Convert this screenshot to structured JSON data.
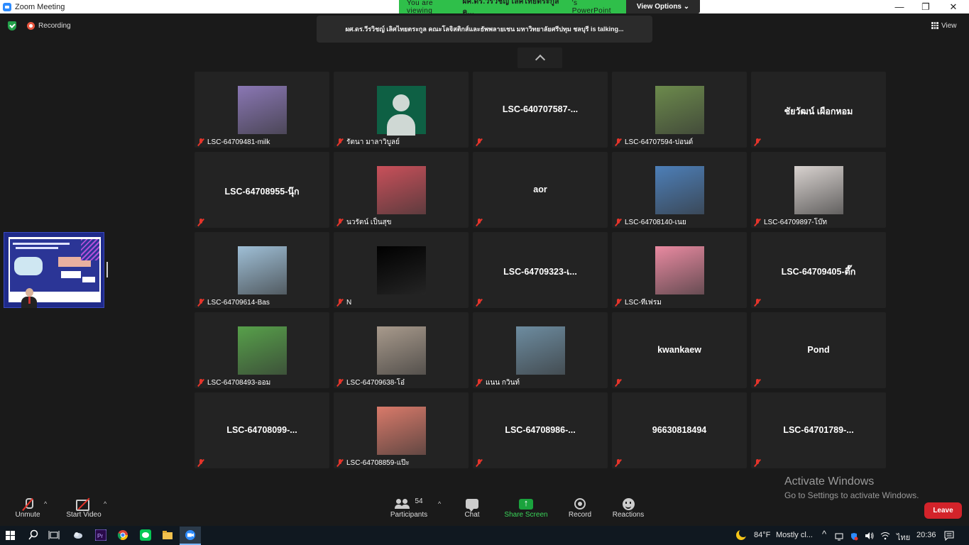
{
  "window": {
    "title": "Zoom Meeting",
    "minimize": "—",
    "restore": "❐",
    "close": "✕"
  },
  "banner": {
    "viewing_prefix": "You are viewing ",
    "presenter": "ผศ.ดร.วีรวิชญ์ เลิศไทยตระกูล ค...",
    "viewing_suffix": "'s PowerPoint",
    "view_options": "View Options ⌄"
  },
  "status": {
    "recording": "Recording",
    "view": "View"
  },
  "talking": "ผศ.ดร.วีรวิชญ์ เลิศไทยตระกูล คณะโลจิสติกส์และธัพพลายเชน มหาวิทยาลัยศรีปทุม ชลบุรี is  talking...",
  "participants": [
    {
      "label": "LSC-64709481-milk",
      "big": "",
      "photo": "#8a77b4"
    },
    {
      "label": "รัตนา มาลาวิบูลย์",
      "big": "",
      "photo": "default"
    },
    {
      "label": "",
      "big": "LSC-640707587-...",
      "photo": ""
    },
    {
      "label": "LSC-64707594-ปอนด์",
      "big": "",
      "photo": "#6c8a4c"
    },
    {
      "label": "",
      "big": "ชัยวัฒน์ เผือกหอม",
      "photo": ""
    },
    {
      "label": "",
      "big": "LSC-64708955-นุ๊ก",
      "photo": ""
    },
    {
      "label": "นวรัตน์ เป็นสุข",
      "big": "",
      "photo": "#c9505a"
    },
    {
      "label": "",
      "big": "aor",
      "photo": ""
    },
    {
      "label": "LSC-64708140-เนย",
      "big": "",
      "photo": "#4d7fb8"
    },
    {
      "label": "LSC-64709897-โบ๊ท",
      "big": "",
      "photo": "#d8d2cf"
    },
    {
      "label": "LSC-64709614-Bas",
      "big": "",
      "photo": "#9fbfd6"
    },
    {
      "label": "N",
      "big": "",
      "photo": "#000000"
    },
    {
      "label": "",
      "big": "LSC-64709323-เ...",
      "photo": ""
    },
    {
      "label": "LSC-ทีเฟรม",
      "big": "",
      "photo": "#e98aa1"
    },
    {
      "label": "",
      "big": "LSC-64709405-ตึ๊ก",
      "photo": ""
    },
    {
      "label": "LSC-64708493-ออม",
      "big": "",
      "photo": "#57a04a"
    },
    {
      "label": "LSC-64709638-โอ๋",
      "big": "",
      "photo": "#a89a8c"
    },
    {
      "label": "แนน กวินท์",
      "big": "",
      "photo": "#6d8ca0"
    },
    {
      "label": "",
      "big": "kwankaew",
      "photo": ""
    },
    {
      "label": "",
      "big": "Pond",
      "photo": ""
    },
    {
      "label": "",
      "big": "LSC-64708099-...",
      "photo": ""
    },
    {
      "label": "LSC-64708859-แป๊ะ",
      "big": "",
      "photo": "#d97a6a"
    },
    {
      "label": "",
      "big": "LSC-64708986-...",
      "photo": ""
    },
    {
      "label": "",
      "big": "96630818494",
      "photo": ""
    },
    {
      "label": "",
      "big": "LSC-64701789-...",
      "photo": ""
    }
  ],
  "toolbar": {
    "unmute": "Unmute",
    "start_video": "Start Video",
    "participants": "Participants",
    "participant_count": "54",
    "chat": "Chat",
    "share_screen": "Share Screen",
    "record": "Record",
    "reactions": "Reactions",
    "leave": "Leave"
  },
  "activate": {
    "title": "Activate Windows",
    "subtitle": "Go to Settings to activate Windows."
  },
  "taskbar": {
    "weather": "84°F",
    "weather_desc": "Mostly cl...",
    "language": "ไทย",
    "time": "20:36"
  },
  "colors": {
    "accent_green": "#2fbf4a",
    "leave_red": "#d3232a",
    "muted_red": "#e5342a"
  }
}
